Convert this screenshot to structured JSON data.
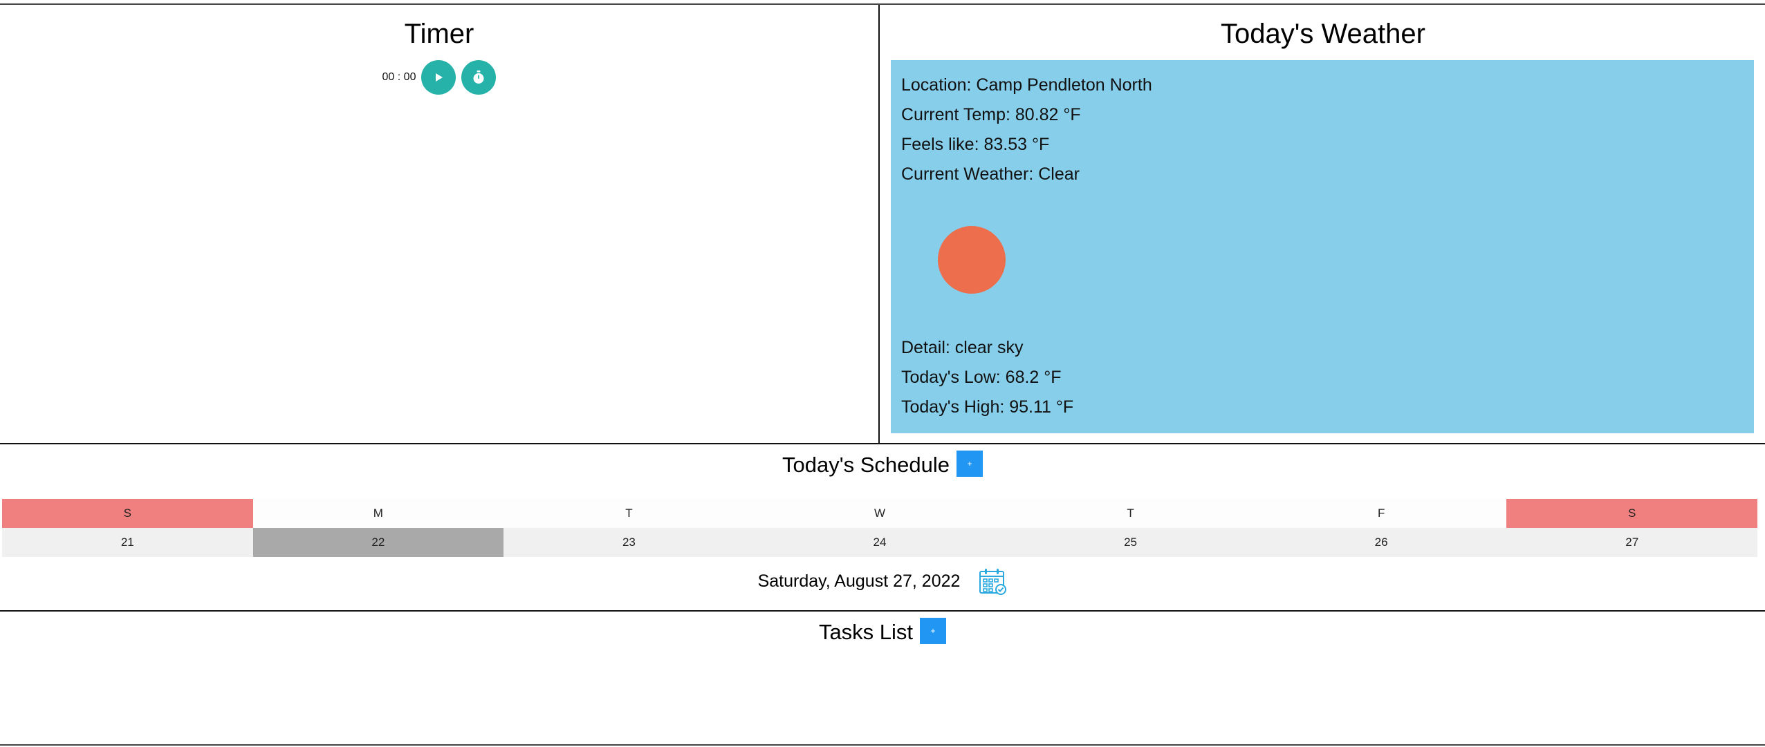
{
  "timer": {
    "title": "Timer",
    "display": "00 : 00",
    "play_icon": "play-icon",
    "stopwatch_icon": "stopwatch-icon",
    "accent": "#26b2a9"
  },
  "weather": {
    "title": "Today's Weather",
    "location": "Location: Camp Pendleton North",
    "current_temp": "Current Temp: 80.82 °F",
    "feels_like": "Feels like: 83.53 °F",
    "current_weather": "Current Weather: Clear",
    "detail": "Detail: clear sky",
    "low": "Today's Low: 68.2 °F",
    "high": "Today's High: 95.11 °F",
    "box_color": "#87ceeb",
    "sun_color": "#ec6e4c",
    "icon": "sun-icon"
  },
  "schedule": {
    "title": "Today's Schedule",
    "add_label": "+",
    "days": [
      {
        "name": "S",
        "num": "21",
        "weekend": true,
        "selected": false
      },
      {
        "name": "M",
        "num": "22",
        "weekend": false,
        "selected": true
      },
      {
        "name": "T",
        "num": "23",
        "weekend": false,
        "selected": false
      },
      {
        "name": "W",
        "num": "24",
        "weekend": false,
        "selected": false
      },
      {
        "name": "T",
        "num": "25",
        "weekend": false,
        "selected": false
      },
      {
        "name": "F",
        "num": "26",
        "weekend": false,
        "selected": false
      },
      {
        "name": "S",
        "num": "27",
        "weekend": true,
        "selected": false
      }
    ],
    "date": "Saturday, August 27, 2022",
    "calendar_icon": "calendar-check-icon",
    "weekend_color": "#f08080",
    "selected_color": "#a9a9a9"
  },
  "tasks": {
    "title": "Tasks List",
    "add_label": "+"
  },
  "colors": {
    "add_button": "#2196f3"
  }
}
